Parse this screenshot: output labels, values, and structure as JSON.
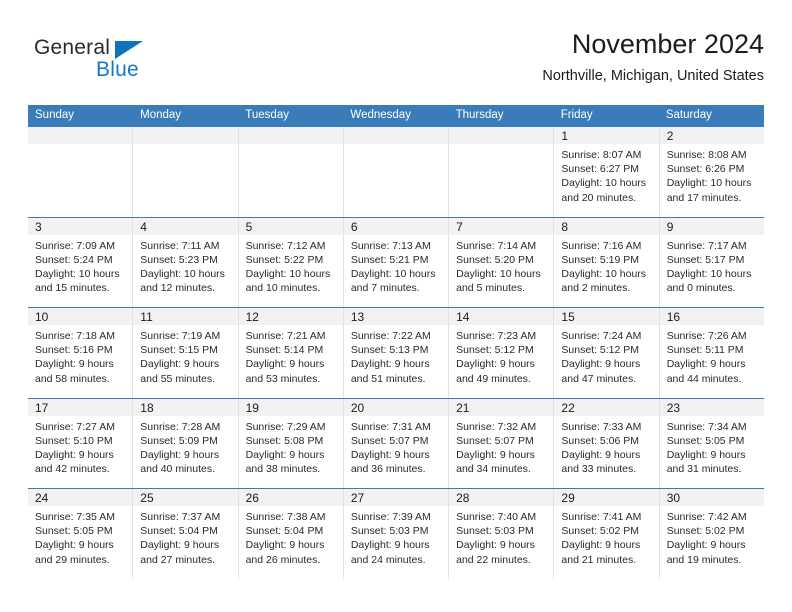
{
  "brand": {
    "name_part1": "General",
    "name_part2": "Blue",
    "triangle_color": "#0f74bd",
    "blue_color": "#1878c6"
  },
  "header": {
    "title": "November 2024",
    "subtitle": "Northville, Michigan, United States"
  },
  "theme": {
    "header_bar": "#3a7cba",
    "day_band": "#f2f2f2",
    "row_divider": "#3a7cba",
    "cell_divider": "#e3e3e3",
    "text": "#1c1c1c"
  },
  "weekdays": [
    "Sunday",
    "Monday",
    "Tuesday",
    "Wednesday",
    "Thursday",
    "Friday",
    "Saturday"
  ],
  "weeks": [
    [
      {
        "day": "",
        "sunrise": "",
        "sunset": "",
        "daylight_line1": "",
        "daylight_line2": ""
      },
      {
        "day": "",
        "sunrise": "",
        "sunset": "",
        "daylight_line1": "",
        "daylight_line2": ""
      },
      {
        "day": "",
        "sunrise": "",
        "sunset": "",
        "daylight_line1": "",
        "daylight_line2": ""
      },
      {
        "day": "",
        "sunrise": "",
        "sunset": "",
        "daylight_line1": "",
        "daylight_line2": ""
      },
      {
        "day": "",
        "sunrise": "",
        "sunset": "",
        "daylight_line1": "",
        "daylight_line2": ""
      },
      {
        "day": "1",
        "sunrise": "Sunrise: 8:07 AM",
        "sunset": "Sunset: 6:27 PM",
        "daylight_line1": "Daylight: 10 hours",
        "daylight_line2": "and 20 minutes."
      },
      {
        "day": "2",
        "sunrise": "Sunrise: 8:08 AM",
        "sunset": "Sunset: 6:26 PM",
        "daylight_line1": "Daylight: 10 hours",
        "daylight_line2": "and 17 minutes."
      }
    ],
    [
      {
        "day": "3",
        "sunrise": "Sunrise: 7:09 AM",
        "sunset": "Sunset: 5:24 PM",
        "daylight_line1": "Daylight: 10 hours",
        "daylight_line2": "and 15 minutes."
      },
      {
        "day": "4",
        "sunrise": "Sunrise: 7:11 AM",
        "sunset": "Sunset: 5:23 PM",
        "daylight_line1": "Daylight: 10 hours",
        "daylight_line2": "and 12 minutes."
      },
      {
        "day": "5",
        "sunrise": "Sunrise: 7:12 AM",
        "sunset": "Sunset: 5:22 PM",
        "daylight_line1": "Daylight: 10 hours",
        "daylight_line2": "and 10 minutes."
      },
      {
        "day": "6",
        "sunrise": "Sunrise: 7:13 AM",
        "sunset": "Sunset: 5:21 PM",
        "daylight_line1": "Daylight: 10 hours",
        "daylight_line2": "and 7 minutes."
      },
      {
        "day": "7",
        "sunrise": "Sunrise: 7:14 AM",
        "sunset": "Sunset: 5:20 PM",
        "daylight_line1": "Daylight: 10 hours",
        "daylight_line2": "and 5 minutes."
      },
      {
        "day": "8",
        "sunrise": "Sunrise: 7:16 AM",
        "sunset": "Sunset: 5:19 PM",
        "daylight_line1": "Daylight: 10 hours",
        "daylight_line2": "and 2 minutes."
      },
      {
        "day": "9",
        "sunrise": "Sunrise: 7:17 AM",
        "sunset": "Sunset: 5:17 PM",
        "daylight_line1": "Daylight: 10 hours",
        "daylight_line2": "and 0 minutes."
      }
    ],
    [
      {
        "day": "10",
        "sunrise": "Sunrise: 7:18 AM",
        "sunset": "Sunset: 5:16 PM",
        "daylight_line1": "Daylight: 9 hours",
        "daylight_line2": "and 58 minutes."
      },
      {
        "day": "11",
        "sunrise": "Sunrise: 7:19 AM",
        "sunset": "Sunset: 5:15 PM",
        "daylight_line1": "Daylight: 9 hours",
        "daylight_line2": "and 55 minutes."
      },
      {
        "day": "12",
        "sunrise": "Sunrise: 7:21 AM",
        "sunset": "Sunset: 5:14 PM",
        "daylight_line1": "Daylight: 9 hours",
        "daylight_line2": "and 53 minutes."
      },
      {
        "day": "13",
        "sunrise": "Sunrise: 7:22 AM",
        "sunset": "Sunset: 5:13 PM",
        "daylight_line1": "Daylight: 9 hours",
        "daylight_line2": "and 51 minutes."
      },
      {
        "day": "14",
        "sunrise": "Sunrise: 7:23 AM",
        "sunset": "Sunset: 5:12 PM",
        "daylight_line1": "Daylight: 9 hours",
        "daylight_line2": "and 49 minutes."
      },
      {
        "day": "15",
        "sunrise": "Sunrise: 7:24 AM",
        "sunset": "Sunset: 5:12 PM",
        "daylight_line1": "Daylight: 9 hours",
        "daylight_line2": "and 47 minutes."
      },
      {
        "day": "16",
        "sunrise": "Sunrise: 7:26 AM",
        "sunset": "Sunset: 5:11 PM",
        "daylight_line1": "Daylight: 9 hours",
        "daylight_line2": "and 44 minutes."
      }
    ],
    [
      {
        "day": "17",
        "sunrise": "Sunrise: 7:27 AM",
        "sunset": "Sunset: 5:10 PM",
        "daylight_line1": "Daylight: 9 hours",
        "daylight_line2": "and 42 minutes."
      },
      {
        "day": "18",
        "sunrise": "Sunrise: 7:28 AM",
        "sunset": "Sunset: 5:09 PM",
        "daylight_line1": "Daylight: 9 hours",
        "daylight_line2": "and 40 minutes."
      },
      {
        "day": "19",
        "sunrise": "Sunrise: 7:29 AM",
        "sunset": "Sunset: 5:08 PM",
        "daylight_line1": "Daylight: 9 hours",
        "daylight_line2": "and 38 minutes."
      },
      {
        "day": "20",
        "sunrise": "Sunrise: 7:31 AM",
        "sunset": "Sunset: 5:07 PM",
        "daylight_line1": "Daylight: 9 hours",
        "daylight_line2": "and 36 minutes."
      },
      {
        "day": "21",
        "sunrise": "Sunrise: 7:32 AM",
        "sunset": "Sunset: 5:07 PM",
        "daylight_line1": "Daylight: 9 hours",
        "daylight_line2": "and 34 minutes."
      },
      {
        "day": "22",
        "sunrise": "Sunrise: 7:33 AM",
        "sunset": "Sunset: 5:06 PM",
        "daylight_line1": "Daylight: 9 hours",
        "daylight_line2": "and 33 minutes."
      },
      {
        "day": "23",
        "sunrise": "Sunrise: 7:34 AM",
        "sunset": "Sunset: 5:05 PM",
        "daylight_line1": "Daylight: 9 hours",
        "daylight_line2": "and 31 minutes."
      }
    ],
    [
      {
        "day": "24",
        "sunrise": "Sunrise: 7:35 AM",
        "sunset": "Sunset: 5:05 PM",
        "daylight_line1": "Daylight: 9 hours",
        "daylight_line2": "and 29 minutes."
      },
      {
        "day": "25",
        "sunrise": "Sunrise: 7:37 AM",
        "sunset": "Sunset: 5:04 PM",
        "daylight_line1": "Daylight: 9 hours",
        "daylight_line2": "and 27 minutes."
      },
      {
        "day": "26",
        "sunrise": "Sunrise: 7:38 AM",
        "sunset": "Sunset: 5:04 PM",
        "daylight_line1": "Daylight: 9 hours",
        "daylight_line2": "and 26 minutes."
      },
      {
        "day": "27",
        "sunrise": "Sunrise: 7:39 AM",
        "sunset": "Sunset: 5:03 PM",
        "daylight_line1": "Daylight: 9 hours",
        "daylight_line2": "and 24 minutes."
      },
      {
        "day": "28",
        "sunrise": "Sunrise: 7:40 AM",
        "sunset": "Sunset: 5:03 PM",
        "daylight_line1": "Daylight: 9 hours",
        "daylight_line2": "and 22 minutes."
      },
      {
        "day": "29",
        "sunrise": "Sunrise: 7:41 AM",
        "sunset": "Sunset: 5:02 PM",
        "daylight_line1": "Daylight: 9 hours",
        "daylight_line2": "and 21 minutes."
      },
      {
        "day": "30",
        "sunrise": "Sunrise: 7:42 AM",
        "sunset": "Sunset: 5:02 PM",
        "daylight_line1": "Daylight: 9 hours",
        "daylight_line2": "and 19 minutes."
      }
    ]
  ]
}
